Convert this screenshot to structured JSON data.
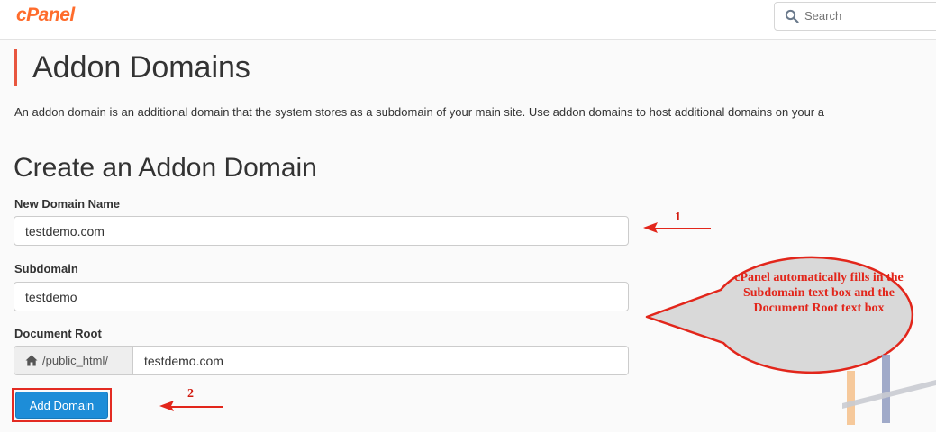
{
  "brand": {
    "logo_text": "cPanel",
    "accent": "#e8563f"
  },
  "search": {
    "placeholder": "Search"
  },
  "page": {
    "title": "Addon Domains",
    "description": "An addon domain is an additional domain that the system stores as a subdomain of your main site. Use addon domains to host additional domains on your a"
  },
  "form": {
    "section_title": "Create an Addon Domain",
    "new_domain_label": "New Domain Name",
    "new_domain_value": "testdemo.com",
    "subdomain_label": "Subdomain",
    "subdomain_value": "testdemo",
    "docroot_label": "Document Root",
    "docroot_prefix": "/public_html/",
    "docroot_value": "testdemo.com",
    "submit_label": "Add Domain",
    "button_color": "#1d8dd8"
  },
  "annotations": {
    "marker_1": "1",
    "marker_2": "2",
    "callout_text": "cPanel automatically fills in the Subdomain text box and the Document Root text box",
    "callout_color": "#e2261b"
  }
}
